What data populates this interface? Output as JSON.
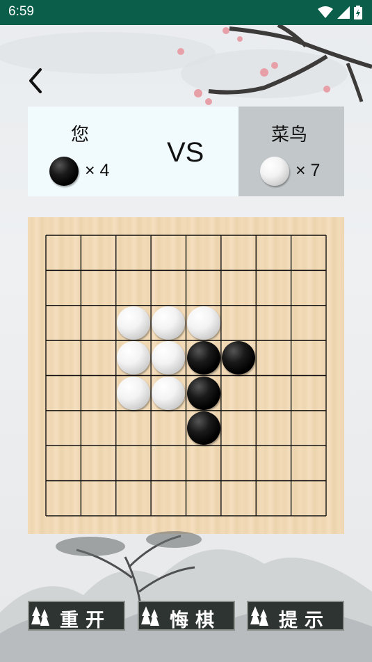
{
  "status": {
    "time": "6:59",
    "icons": [
      "wifi-icon",
      "signal-icon",
      "battery-icon"
    ]
  },
  "header": {
    "back_icon": "chevron-left-icon"
  },
  "players": {
    "me": {
      "name": "您",
      "stone": "black",
      "count_text": "× 4"
    },
    "vs": "VS",
    "opponent": {
      "name": "菜鸟",
      "stone": "white",
      "count_text": "× 7"
    }
  },
  "board": {
    "size": 8,
    "stones": [
      {
        "row": 2,
        "col": 2,
        "color": "white"
      },
      {
        "row": 2,
        "col": 3,
        "color": "white"
      },
      {
        "row": 2,
        "col": 4,
        "color": "white"
      },
      {
        "row": 3,
        "col": 2,
        "color": "white"
      },
      {
        "row": 3,
        "col": 3,
        "color": "white"
      },
      {
        "row": 3,
        "col": 4,
        "color": "black"
      },
      {
        "row": 3,
        "col": 5,
        "color": "black"
      },
      {
        "row": 4,
        "col": 2,
        "color": "white"
      },
      {
        "row": 4,
        "col": 3,
        "color": "white"
      },
      {
        "row": 4,
        "col": 4,
        "color": "black"
      },
      {
        "row": 5,
        "col": 4,
        "color": "black"
      }
    ]
  },
  "buttons": {
    "restart": "重开",
    "undo": "悔棋",
    "hint": "提示"
  },
  "colors": {
    "status_bar": "#0b5f4a",
    "score_left_bg": "#f1fafd",
    "score_right_bg": "#c2c7ca",
    "button_bg": "#2e3431"
  }
}
